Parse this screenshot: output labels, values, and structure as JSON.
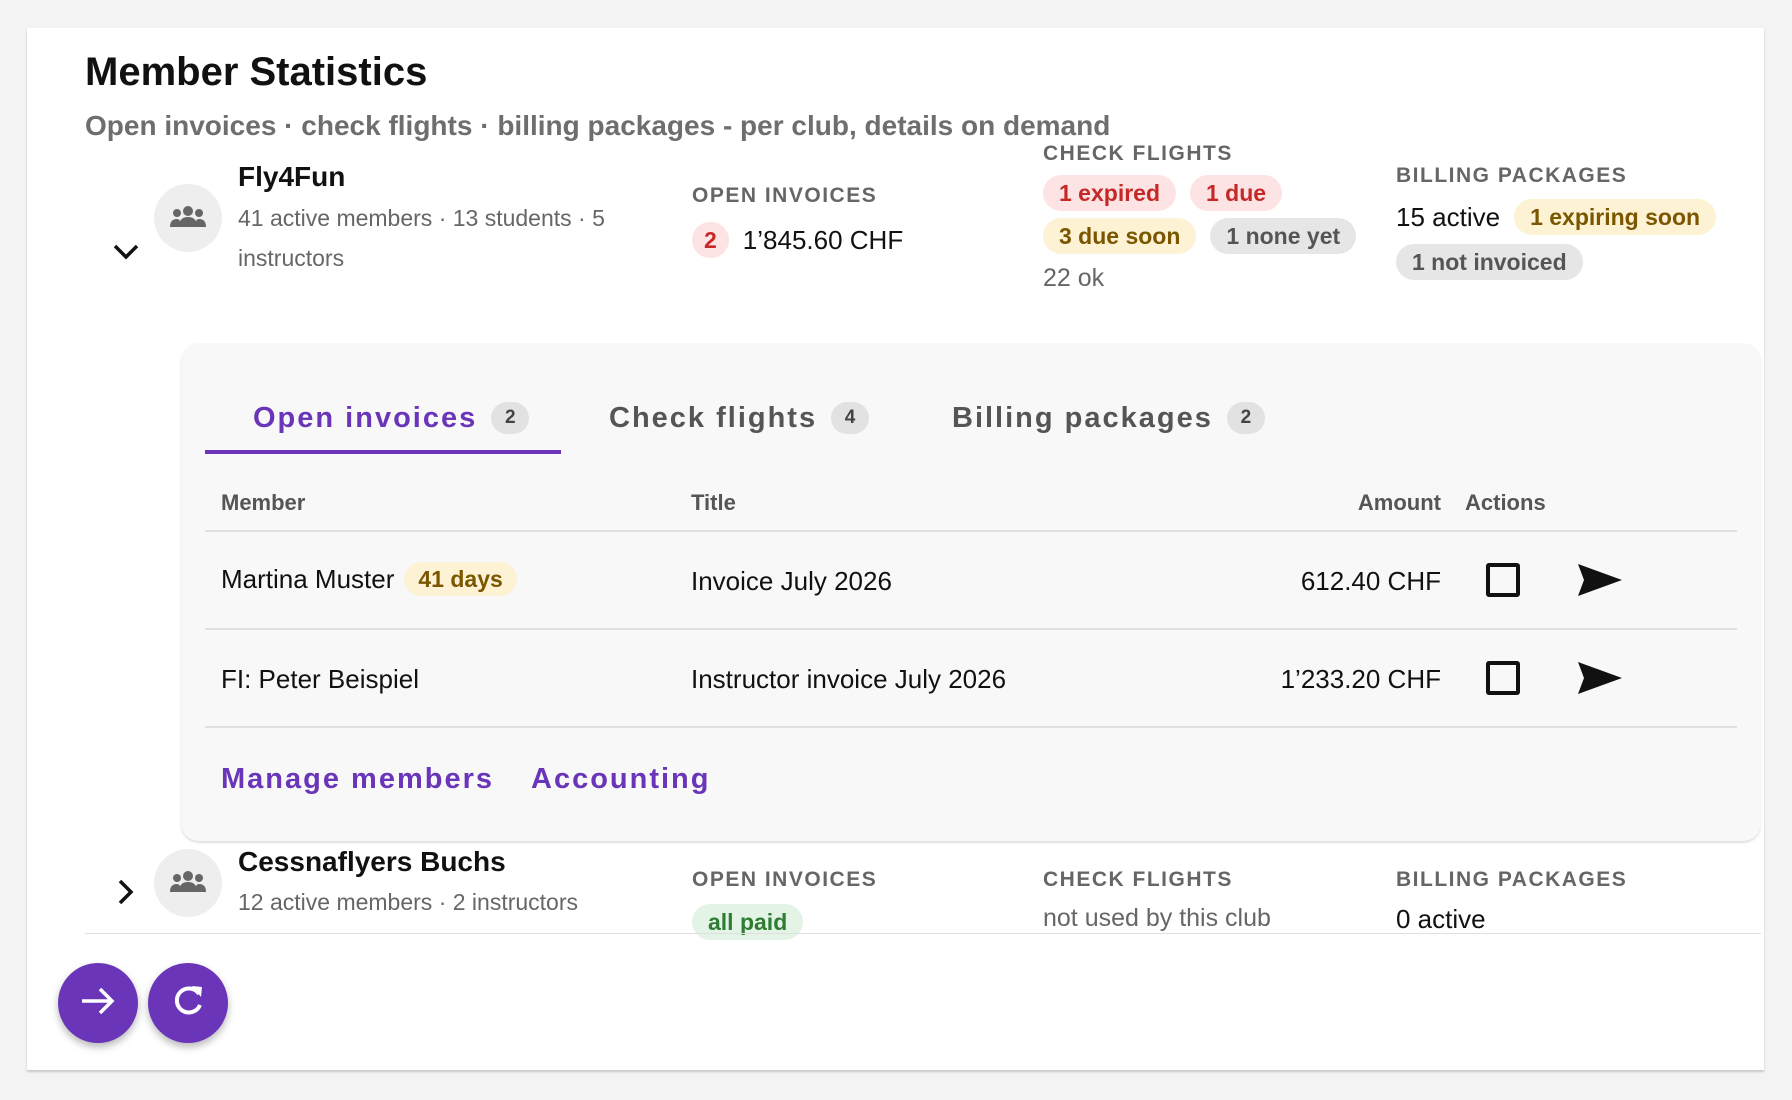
{
  "page": {
    "title": "Member Statistics",
    "subtitle": "Open invoices · check flights · billing packages - per club, details on demand"
  },
  "clubs": [
    {
      "name": "Fly4Fun",
      "meta_line1": "41 active members · 13 students · 5",
      "meta_line2": "instructors",
      "expanded": true,
      "open_invoices": {
        "label": "OPEN INVOICES",
        "count": "2",
        "total": "1’845.60 CHF"
      },
      "check_flights": {
        "label": "CHECK FLIGHTS",
        "expired": "1 expired",
        "due": "1 due",
        "due_soon": "3 due soon",
        "none_yet": "1 none yet",
        "ok": "22 ok"
      },
      "billing_packages": {
        "label": "BILLING PACKAGES",
        "active": "15 active",
        "expiring": "1 expiring soon",
        "not_invoiced": "1 not invoiced"
      }
    },
    {
      "name": "Cessnaflyers Buchs",
      "meta_line1": "12 active members · 2 instructors",
      "expanded": false,
      "open_invoices": {
        "label": "OPEN INVOICES",
        "status": "all paid"
      },
      "check_flights": {
        "label": "CHECK FLIGHTS",
        "status": "not used by this club"
      },
      "billing_packages": {
        "label": "BILLING PACKAGES",
        "active": "0 active"
      }
    }
  ],
  "details": {
    "tabs": [
      {
        "label": "Open invoices",
        "count": "2",
        "active": true
      },
      {
        "label": "Check flights",
        "count": "4",
        "active": false
      },
      {
        "label": "Billing packages",
        "count": "2",
        "active": false
      }
    ],
    "table": {
      "headers": {
        "member": "Member",
        "title": "Title",
        "amount": "Amount",
        "actions": "Actions"
      },
      "rows": [
        {
          "member": "Martina Muster",
          "badge": "41 days",
          "title": "Invoice July 2026",
          "amount": "612.40 CHF"
        },
        {
          "member": "FI: Peter Beispiel",
          "title": "Instructor invoice July 2026",
          "amount": "1’233.20 CHF"
        }
      ]
    },
    "links": {
      "manage_members": "Manage members",
      "accounting": "Accounting"
    }
  },
  "icons": {
    "expand": "chevron-down-icon",
    "collapse": "chevron-right-icon",
    "club": "group-icon",
    "send": "send-icon",
    "next": "arrow-right-icon",
    "refresh": "refresh-icon"
  },
  "colors": {
    "accent": "#6a35b8",
    "red": "#c62828",
    "amber": "#7a5600",
    "green": "#2e7d32"
  }
}
